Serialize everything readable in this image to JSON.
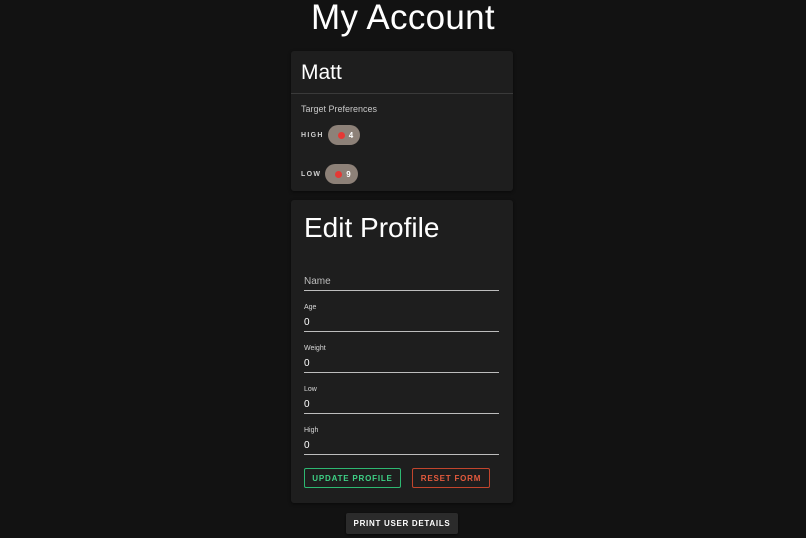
{
  "page": {
    "title": "My Account"
  },
  "user_card": {
    "name": "Matt",
    "preferences_label": "Target Preferences",
    "high": {
      "label": "HIGH",
      "value": "4"
    },
    "low": {
      "label": "LOW",
      "value": "9"
    },
    "chip_color": "#8d8178",
    "dot_color": "#e53935"
  },
  "edit_profile": {
    "title": "Edit Profile",
    "name_placeholder": "Name",
    "fields": {
      "age": {
        "label": "Age",
        "value": "0"
      },
      "weight": {
        "label": "Weight",
        "value": "0"
      },
      "low": {
        "label": "Low",
        "value": "0"
      },
      "high": {
        "label": "High",
        "value": "0"
      }
    },
    "update_label": "UPDATE PROFILE",
    "reset_label": "RESET FORM",
    "update_color": "#2eb872",
    "reset_color": "#c2452d"
  },
  "actions": {
    "print_label": "PRINT USER DETAILS"
  }
}
